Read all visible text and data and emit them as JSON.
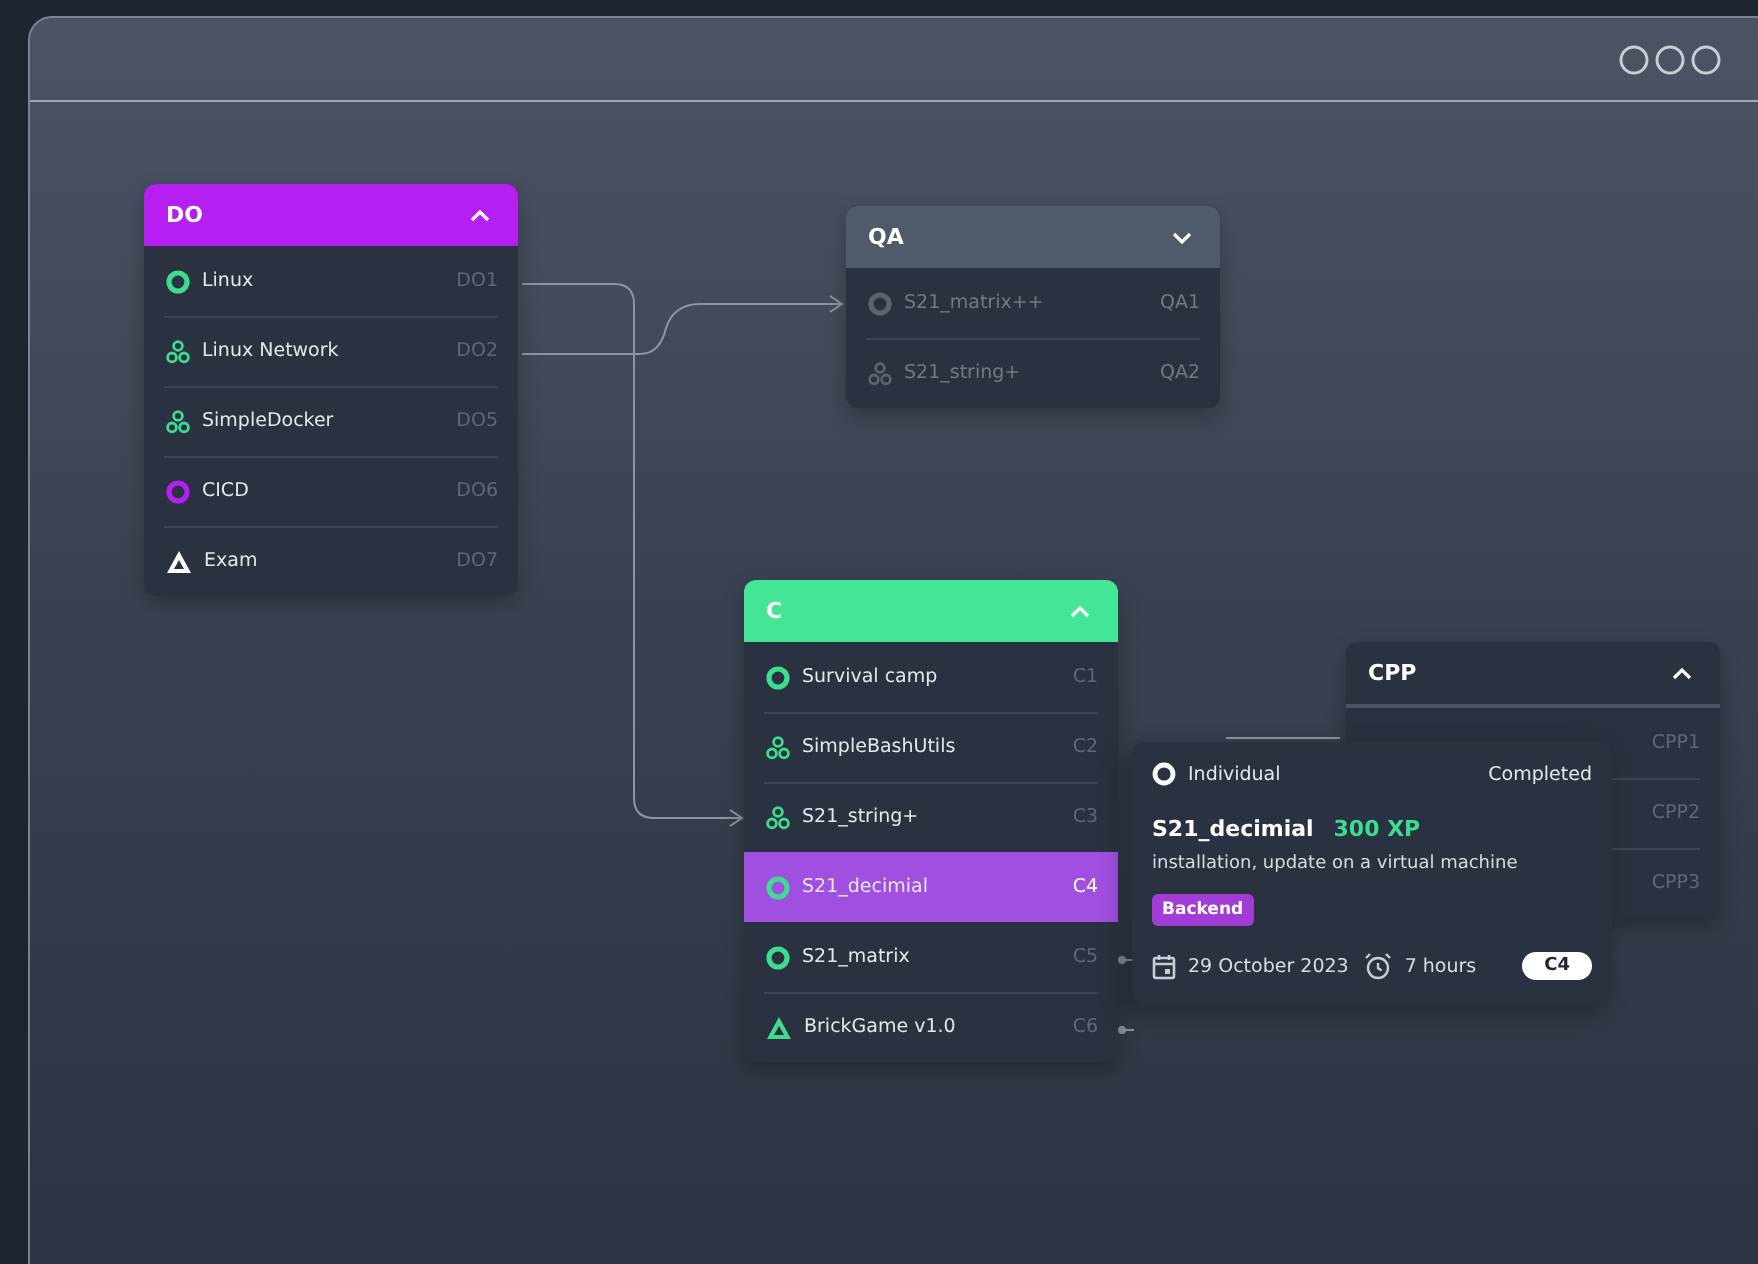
{
  "groups": [
    {
      "title": "DO",
      "color": "#b61ff2",
      "expanded": true,
      "items": [
        {
          "name": "Linux",
          "code": "DO1",
          "kind": "ring",
          "color": "#3ddc91",
          "selected": false
        },
        {
          "name": "Linux Network",
          "code": "DO2",
          "kind": "cluster",
          "color": "#3ddc91",
          "selected": false
        },
        {
          "name": "SimpleDocker",
          "code": "DO5",
          "kind": "cluster",
          "color": "#3ddc91",
          "selected": false
        },
        {
          "name": "CICD",
          "code": "DO6",
          "kind": "ring",
          "color": "#b61ff2",
          "selected": false
        },
        {
          "name": "Exam",
          "code": "DO7",
          "kind": "exam",
          "color": "#ffffff",
          "selected": false
        }
      ]
    },
    {
      "title": "QA",
      "color": "#4f5b6b",
      "expanded": false,
      "items": [
        {
          "name": "S21_matrix++",
          "code": "QA1",
          "kind": "ring",
          "color": "#5b6370",
          "selected": false
        },
        {
          "name": "S21_string+",
          "code": "QA2",
          "kind": "cluster",
          "color": "#5b6370",
          "selected": false
        }
      ]
    },
    {
      "title": "C",
      "color": "#45e598",
      "expanded": true,
      "items": [
        {
          "name": "Survival camp",
          "code": "C1",
          "kind": "ring",
          "color": "#3ddc91",
          "selected": false
        },
        {
          "name": "SimpleBashUtils",
          "code": "C2",
          "kind": "cluster",
          "color": "#3ddc91",
          "selected": false
        },
        {
          "name": "S21_string+",
          "code": "C3",
          "kind": "cluster",
          "color": "#3ddc91",
          "selected": false
        },
        {
          "name": "S21_decimial",
          "code": "C4",
          "kind": "ring",
          "color": "#3ddc91",
          "selected": true
        },
        {
          "name": "S21_matrix",
          "code": "C5",
          "kind": "ring",
          "color": "#3ddc91",
          "selected": false
        },
        {
          "name": "BrickGame v1.0",
          "code": "C6",
          "kind": "exam",
          "color": "#3ddc91",
          "selected": false
        }
      ]
    },
    {
      "title": "CPP",
      "color": "#2a3140",
      "expanded": true,
      "items": [
        {
          "code": "CPP1",
          "selected": false
        },
        {
          "code": "CPP2",
          "selected": false
        },
        {
          "code": "CPP3",
          "selected": false
        }
      ]
    }
  ],
  "tooltip": {
    "type": "Individual",
    "status": "Completed",
    "title": "S21_decimial",
    "xp": "300 XP",
    "description": "installation, update on a virtual machine",
    "tag": "Backend",
    "date": "29 October 2023",
    "duration": "7 hours",
    "code": "C4"
  }
}
